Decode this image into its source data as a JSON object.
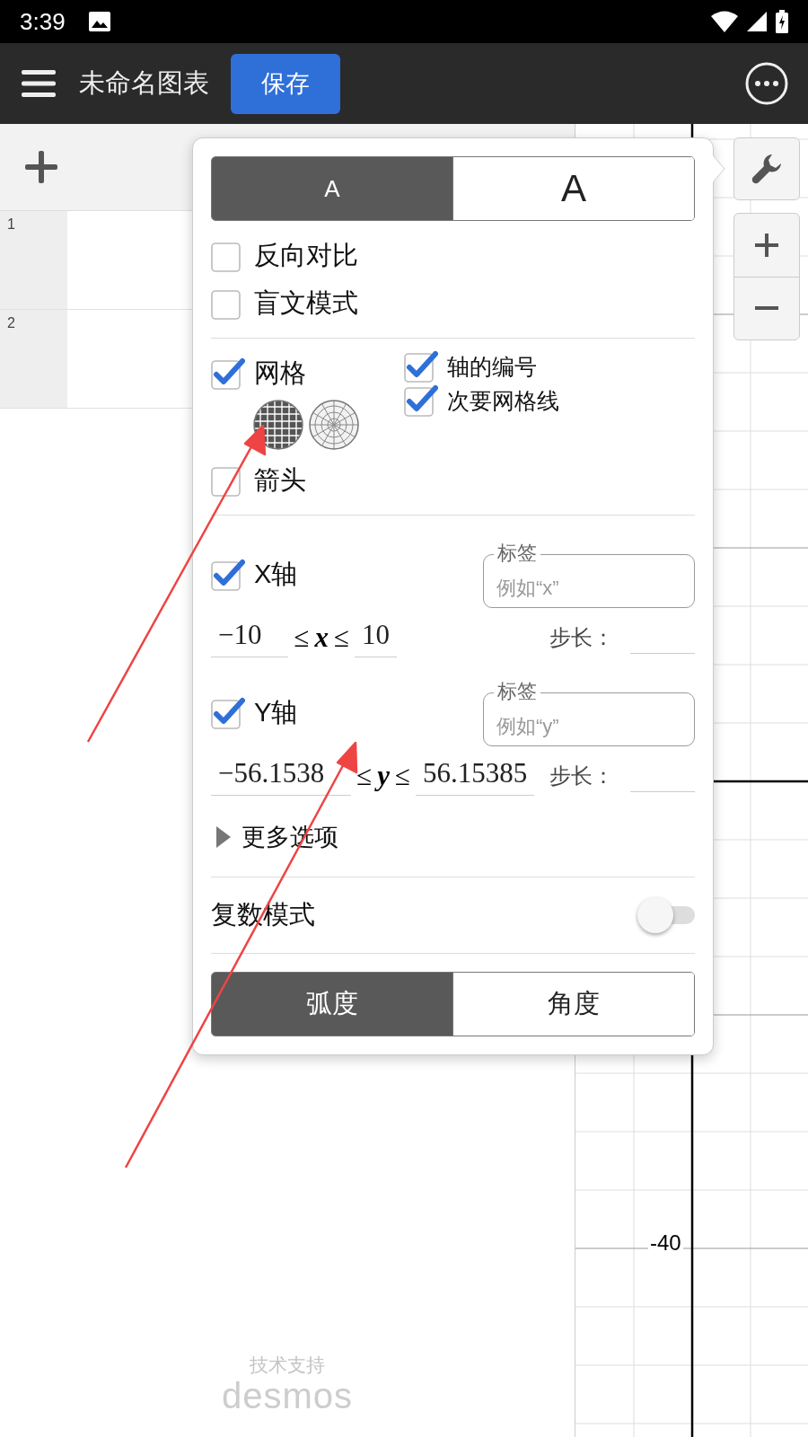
{
  "status_bar": {
    "time": "3:39"
  },
  "toolbar": {
    "title": "未命名图表",
    "save_button": "保存"
  },
  "expressions": [
    {
      "number": "1"
    },
    {
      "number": "2"
    }
  ],
  "graph": {
    "tick_label": "-40"
  },
  "settings": {
    "text_size": [
      {
        "label": "A",
        "kind": "small",
        "selected": true
      },
      {
        "label": "A",
        "kind": "large",
        "selected": false
      }
    ],
    "display_options": [
      {
        "label": "反向对比",
        "checked": false
      },
      {
        "label": "盲文模式",
        "checked": false
      }
    ],
    "grid": {
      "label": "网格",
      "checked": true,
      "types": [
        {
          "kind": "cartesian",
          "selected": true
        },
        {
          "kind": "polar",
          "selected": false
        }
      ]
    },
    "arrows": {
      "label": "箭头",
      "checked": false
    },
    "axis_options": [
      {
        "label": "轴的编号",
        "checked": true
      },
      {
        "label": "次要网格线",
        "checked": true
      }
    ],
    "axes": [
      {
        "label": "X轴",
        "checked": true,
        "legend": "标签",
        "placeholder": "例如“x”",
        "min": "−10",
        "relation": "≤",
        "variable": "x",
        "max": "10",
        "step_label": "步长："
      },
      {
        "label": "Y轴",
        "checked": true,
        "legend": "标签",
        "placeholder": "例如“y”",
        "min": "−56.1538",
        "relation": "≤",
        "variable": "y",
        "max": "56.15385",
        "step_label": "步长："
      }
    ],
    "more_options": {
      "label": "更多选项",
      "expanded": false
    },
    "complex_mode": {
      "label": "复数模式",
      "on": false
    },
    "angle_units": [
      {
        "label": "弧度",
        "selected": true
      },
      {
        "label": "角度",
        "selected": false
      }
    ]
  },
  "footer": {
    "caption": "技术支持",
    "logo": "desmos"
  }
}
